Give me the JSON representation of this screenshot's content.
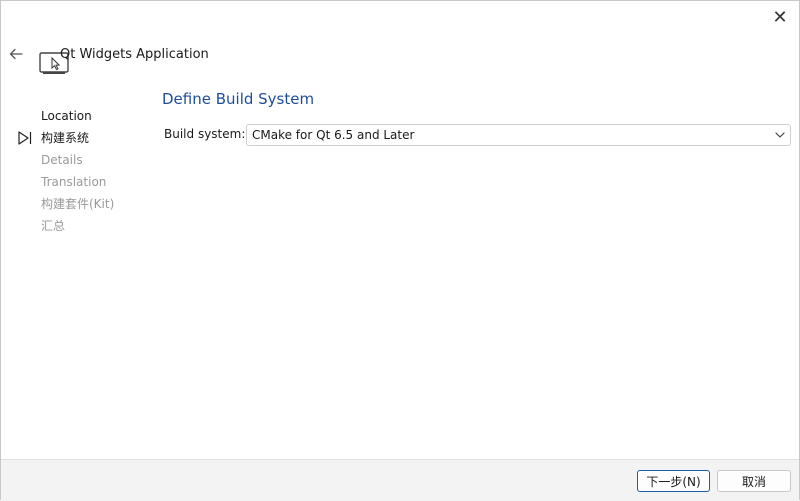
{
  "window": {
    "title": "Qt Widgets Application",
    "close_glyph": "✕",
    "icons": {
      "close": "close-icon",
      "back": "back-arrow-icon",
      "app": "laptop-cursor-icon"
    }
  },
  "steps": [
    {
      "label": "Location",
      "state": "done"
    },
    {
      "label": "构建系统",
      "state": "current"
    },
    {
      "label": "Details",
      "state": "pending"
    },
    {
      "label": "Translation",
      "state": "pending"
    },
    {
      "label": "构建套件(Kit)",
      "state": "pending"
    },
    {
      "label": "汇总",
      "state": "pending"
    }
  ],
  "page": {
    "title": "Define Build System",
    "build_system_label": "Build system:",
    "build_system_value": "CMake for Qt 6.5 and Later"
  },
  "footer": {
    "next_label": "下一步(N)",
    "cancel_label": "取消"
  },
  "colors": {
    "accent": "#1f4e99",
    "pending_step": "#9a9a9a",
    "footer_bg": "#f3f3f3"
  }
}
